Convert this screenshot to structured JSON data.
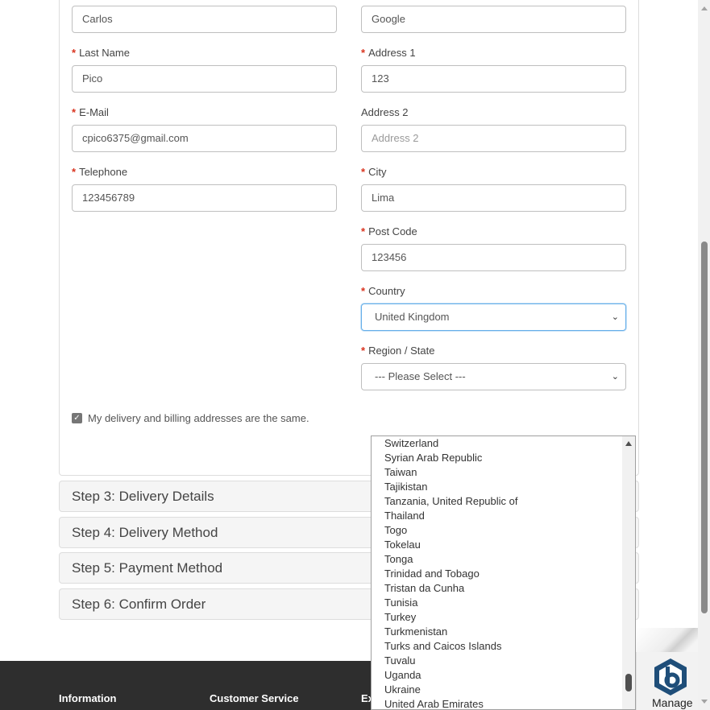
{
  "form": {
    "first_name": {
      "value": "Carlos"
    },
    "company": {
      "value": "Google"
    },
    "last_name": {
      "label": "Last Name",
      "value": "Pico"
    },
    "address_1": {
      "label": "Address 1",
      "value": "123"
    },
    "email": {
      "label": "E-Mail",
      "value": "cpico6375@gmail.com"
    },
    "address_2": {
      "label": "Address 2",
      "placeholder": "Address 2"
    },
    "telephone": {
      "label": "Telephone",
      "value": "123456789"
    },
    "city": {
      "label": "City",
      "value": "Lima"
    },
    "post_code": {
      "label": "Post Code",
      "value": "123456"
    },
    "country": {
      "label": "Country",
      "value": "United Kingdom"
    },
    "region": {
      "label": "Region / State",
      "value": "--- Please Select ---"
    },
    "required_mark": "*",
    "same_address_label": "My delivery and billing addresses are the same.",
    "same_address_checked": true
  },
  "steps": [
    {
      "label": "Step 3: Delivery Details"
    },
    {
      "label": "Step 4: Delivery Method"
    },
    {
      "label": "Step 5: Payment Method"
    },
    {
      "label": "Step 6: Confirm Order"
    }
  ],
  "country_options": [
    "Switzerland",
    "Syrian Arab Republic",
    "Taiwan",
    "Tajikistan",
    "Tanzania, United Republic of",
    "Thailand",
    "Togo",
    "Tokelau",
    "Tonga",
    "Trinidad and Tobago",
    "Tristan da Cunha",
    "Tunisia",
    "Turkey",
    "Turkmenistan",
    "Turks and Caicos Islands",
    "Tuvalu",
    "Uganda",
    "Ukraine",
    "United Arab Emirates"
  ],
  "footer": {
    "information": "Information",
    "customer_service": "Customer Service",
    "extras": "Ex"
  },
  "manage_widget": {
    "label": "Manage",
    "icon": "manage-logo-icon"
  },
  "colors": {
    "required": "#d9331e",
    "focus_border": "#66afe9",
    "footer_bg": "#2e2e2e",
    "step_bg": "#f5f5f5"
  }
}
